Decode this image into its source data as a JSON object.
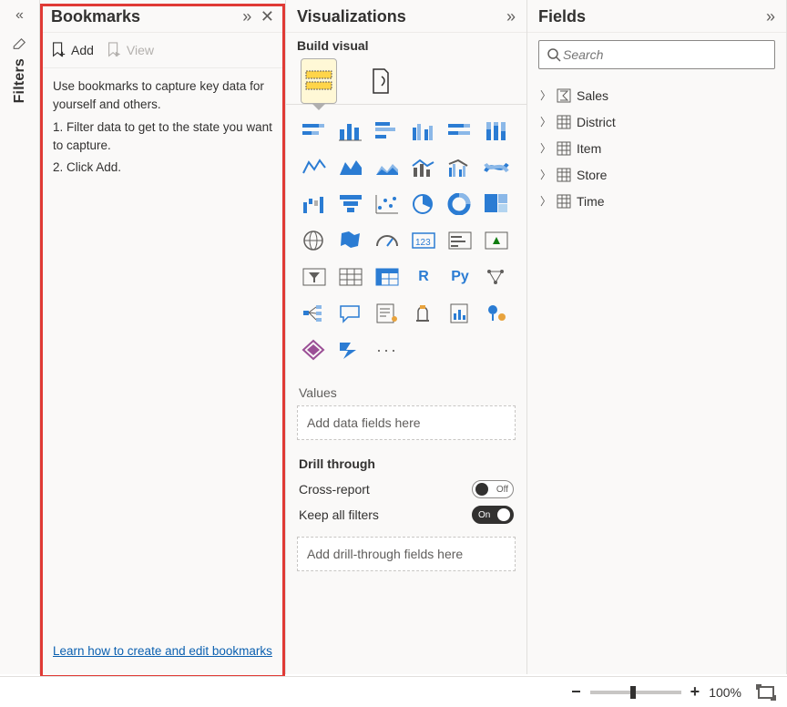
{
  "filters": {
    "label": "Filters"
  },
  "bookmarks": {
    "title": "Bookmarks",
    "add_label": "Add",
    "view_label": "View",
    "intro": "Use bookmarks to capture key data for yourself and others.",
    "step1": "1. Filter data to get to the state you want to capture.",
    "step2": "2. Click Add.",
    "help_link": "Learn how to create and edit bookmarks"
  },
  "viz": {
    "title": "Visualizations",
    "subtitle": "Build visual",
    "values_label": "Values",
    "values_placeholder": "Add data fields here",
    "drill_label": "Drill through",
    "cross_report_label": "Cross-report",
    "cross_report_state": "Off",
    "keep_filters_label": "Keep all filters",
    "keep_filters_state": "On",
    "drill_placeholder": "Add drill-through fields here",
    "r_label": "R",
    "py_label": "Py",
    "more_label": "···"
  },
  "fields": {
    "title": "Fields",
    "search_placeholder": "Search",
    "tables": [
      {
        "name": "Sales",
        "icon": "sigma"
      },
      {
        "name": "District",
        "icon": "table"
      },
      {
        "name": "Item",
        "icon": "table"
      },
      {
        "name": "Store",
        "icon": "table"
      },
      {
        "name": "Time",
        "icon": "table"
      }
    ]
  },
  "zoom": {
    "level": "100%"
  }
}
